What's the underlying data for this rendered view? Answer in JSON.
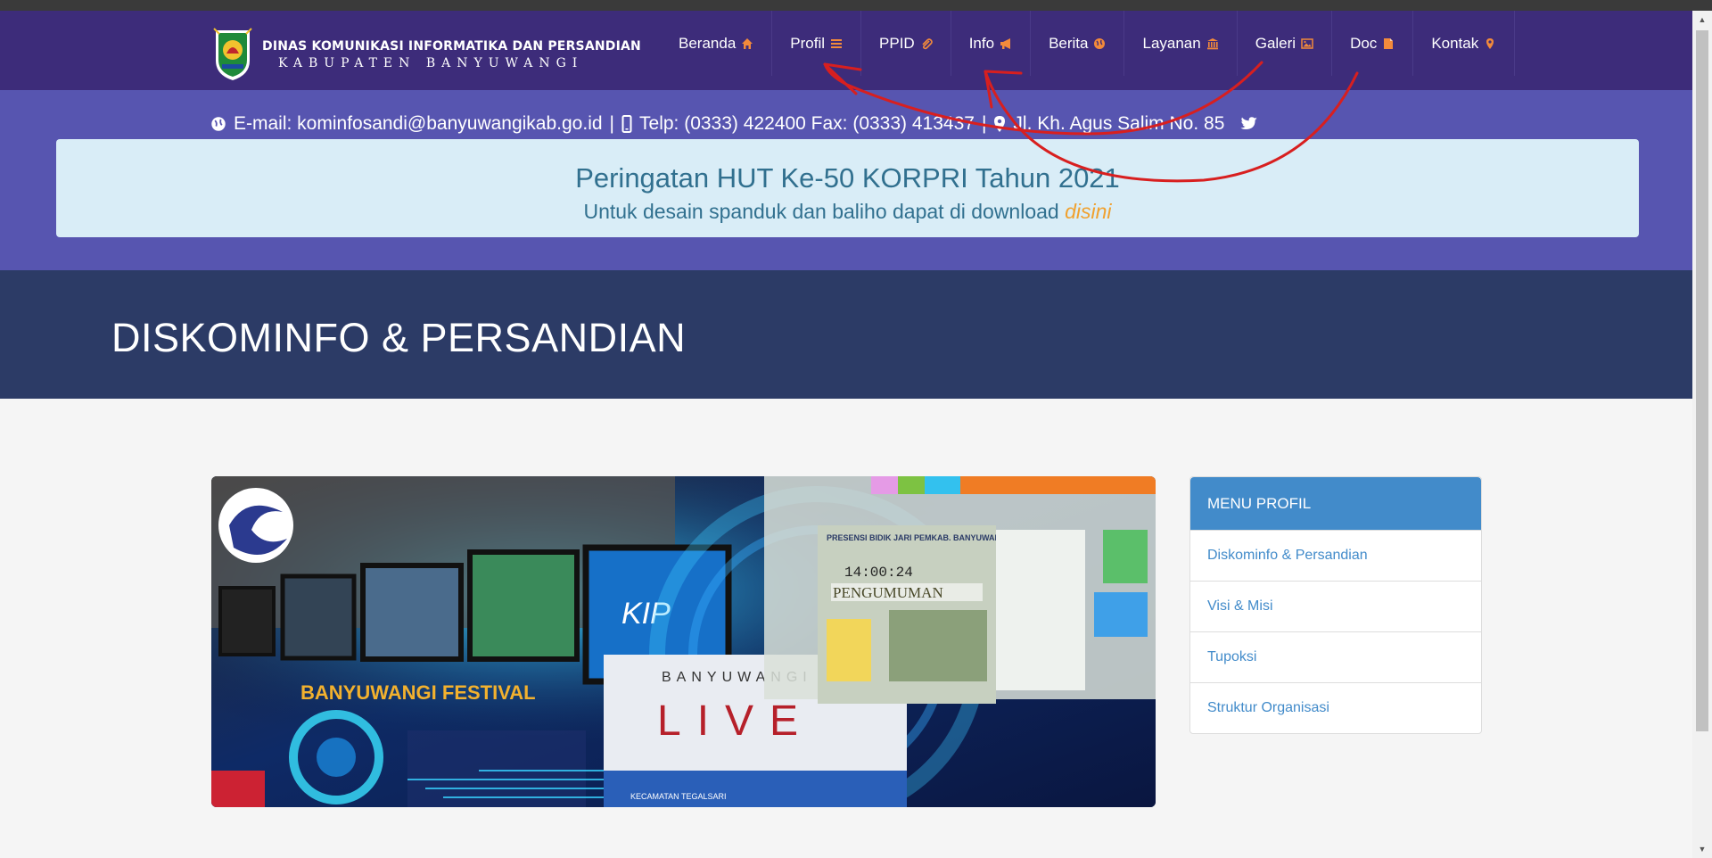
{
  "brand": {
    "line1": "DINAS KOMUNIKASI INFORMATIKA DAN PERSANDIAN",
    "line2": "KABUPATEN BANYUWANGI"
  },
  "nav": [
    {
      "label": "Beranda",
      "icon": "home-icon"
    },
    {
      "label": "Profil",
      "icon": "bars-icon"
    },
    {
      "label": "PPID",
      "icon": "paperclip-icon"
    },
    {
      "label": "Info",
      "icon": "bullhorn-icon"
    },
    {
      "label": "Berita",
      "icon": "globe-icon"
    },
    {
      "label": "Layanan",
      "icon": "institution-icon"
    },
    {
      "label": "Galeri",
      "icon": "image-icon"
    },
    {
      "label": "Doc",
      "icon": "file-icon"
    },
    {
      "label": "Kontak",
      "icon": "map-marker-icon"
    }
  ],
  "contact": {
    "email": "E-mail: kominfosandi@banyuwangikab.go.id",
    "phone": "Telp: (0333) 422400 Fax: (0333) 413437",
    "address": "Jl. Kh. Agus Salim No. 85",
    "sep": "|"
  },
  "alert": {
    "title": "Peringatan HUT Ke-50 KORPRI Tahun 2021",
    "sub": "Untuk desain spanduk dan baliho dapat di download",
    "link": "disini"
  },
  "page_title": "DISKOMINFO & PERSANDIAN",
  "hero_overlay": {
    "kip": "KIP",
    "banyuwangi_festival": "BANYUWANGI FESTIVAL",
    "live": "LIVE",
    "banyuwangi": "BANYUWANGI",
    "presensi": "PRESENSI BIDIK JARI PEMKAB. BANYUWANGI",
    "clock": "14:00:24",
    "pengumuman": "PENGUMUMAN",
    "kecamatan": "KECAMATAN TEGALSARI"
  },
  "menu": {
    "heading": "MENU PROFIL",
    "items": [
      "Diskominfo & Persandian",
      "Visi & Misi",
      "Tupoksi",
      "Struktur Organisasi"
    ]
  },
  "colors": {
    "nav_bg": "#3d2c7a",
    "band_bg": "#5755b0",
    "title_bg": "#2c3b66",
    "accent": "#f28a3b",
    "link": "#428bca",
    "annotation": "#d81f1f"
  }
}
